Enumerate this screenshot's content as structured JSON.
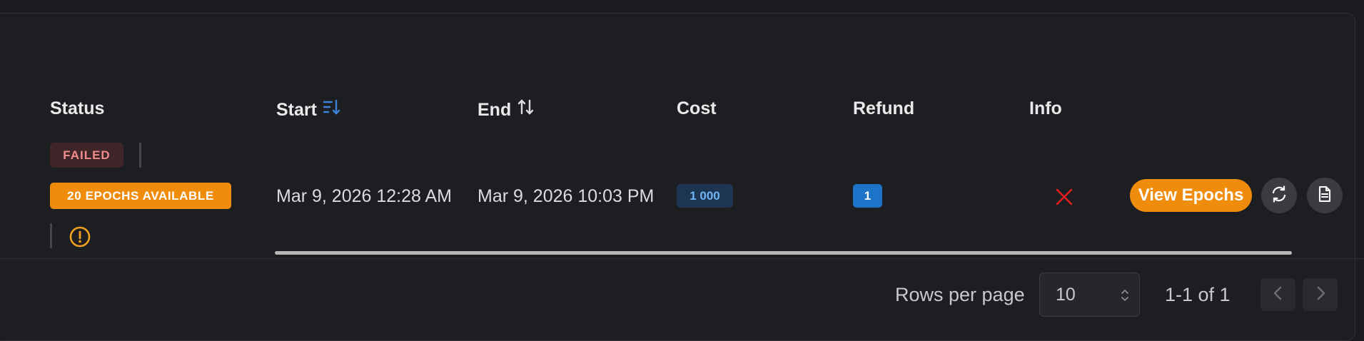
{
  "table": {
    "columns": [
      {
        "key": "status",
        "label": "Status"
      },
      {
        "key": "start",
        "label": "Start",
        "sort_icon": "sort-desc-icon",
        "sort_color": "#3d82d9"
      },
      {
        "key": "end",
        "label": "End",
        "sort_icon": "sort-both-icon"
      },
      {
        "key": "cost",
        "label": "Cost"
      },
      {
        "key": "refund",
        "label": "Refund"
      },
      {
        "key": "info",
        "label": "Info"
      }
    ],
    "rows": [
      {
        "status_badge": "FAILED",
        "epochs_badge": "20 EPOCHS AVAILABLE",
        "warning_icon": "warning-circle-icon",
        "start": "Mar 9, 2026 12:28 AM",
        "end": "Mar 9, 2026 10:03 PM",
        "cost": "1 000",
        "refund": "1",
        "info_icon": "close-icon",
        "view_button": "View Epochs",
        "refresh_icon": "refresh-icon",
        "document_icon": "document-icon"
      }
    ]
  },
  "pagination": {
    "rows_per_page_label": "Rows per page",
    "rows_per_page_value": "10",
    "range_text": "1-1 of 1",
    "prev_icon": "chevron-left-icon",
    "next_icon": "chevron-right-icon"
  },
  "colors": {
    "background": "#1b1c1f",
    "accent_orange": "#f08c0c",
    "failed_bg": "#3d2528",
    "failed_text": "#f08c8c",
    "cost_bg": "#1e3552",
    "cost_text": "#6fb5f3",
    "refund_bg": "#1d73c8",
    "info_x": "#e01e1e",
    "warning": "#f0a020"
  }
}
